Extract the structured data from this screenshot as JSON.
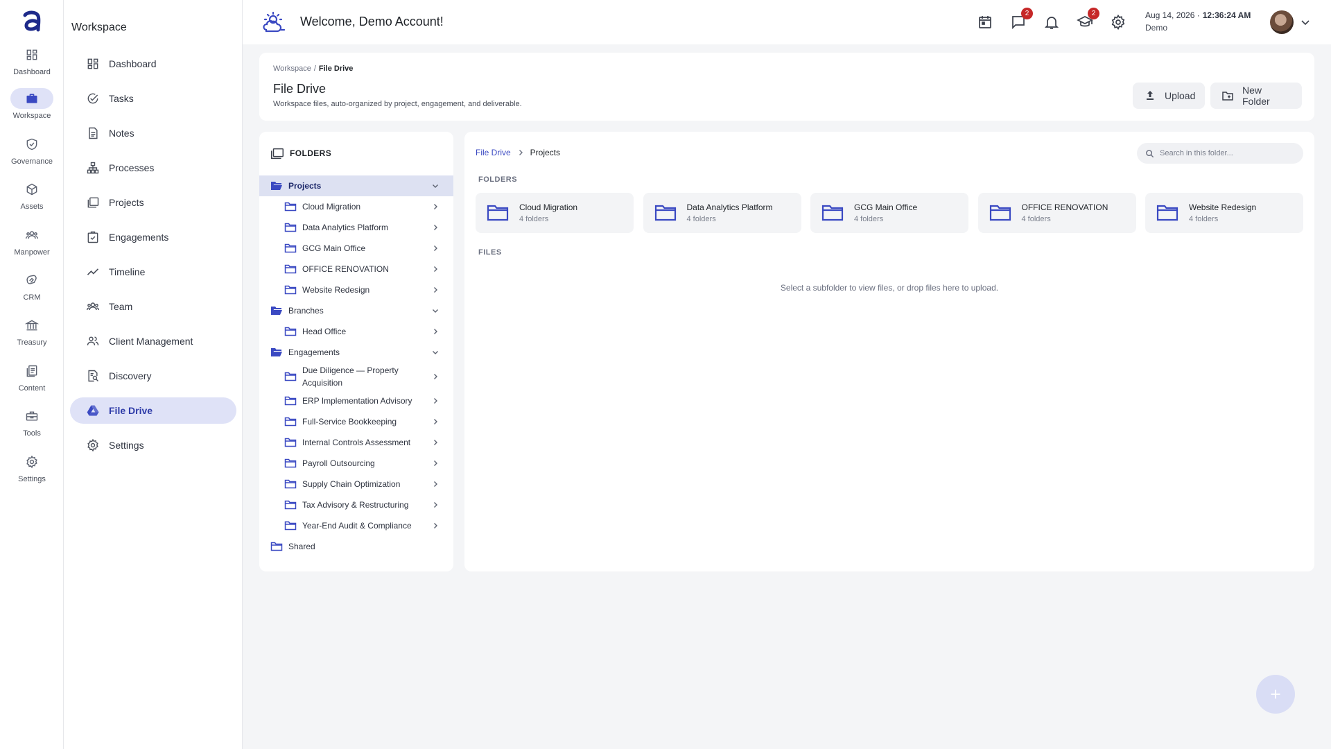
{
  "rail": {
    "items": [
      {
        "label": "Dashboard",
        "icon": "dashboard-icon"
      },
      {
        "label": "Workspace",
        "icon": "briefcase-icon"
      },
      {
        "label": "Governance",
        "icon": "shield-check-icon"
      },
      {
        "label": "Assets",
        "icon": "cube-icon"
      },
      {
        "label": "Manpower",
        "icon": "people-icon"
      },
      {
        "label": "CRM",
        "icon": "handshake-icon"
      },
      {
        "label": "Treasury",
        "icon": "bank-icon"
      },
      {
        "label": "Content",
        "icon": "document-stack-icon"
      },
      {
        "label": "Tools",
        "icon": "toolbox-icon"
      },
      {
        "label": "Settings",
        "icon": "gear-icon"
      }
    ]
  },
  "sidebar": {
    "title": "Workspace",
    "items": [
      {
        "label": "Dashboard"
      },
      {
        "label": "Tasks"
      },
      {
        "label": "Notes"
      },
      {
        "label": "Processes"
      },
      {
        "label": "Projects"
      },
      {
        "label": "Engagements"
      },
      {
        "label": "Timeline"
      },
      {
        "label": "Team"
      },
      {
        "label": "Client Management"
      },
      {
        "label": "Discovery"
      },
      {
        "label": "File Drive"
      },
      {
        "label": "Settings"
      }
    ]
  },
  "header": {
    "title": "Welcome, Demo Account!",
    "messages_badge": "2",
    "courses_badge": "2",
    "date": "Aug 14, 2026 ·",
    "time": "12:36:24 AM",
    "user": "Demo"
  },
  "page": {
    "breadcrumb_root": "Workspace",
    "breadcrumb_sep": "/",
    "breadcrumb_current": "File Drive",
    "title": "File Drive",
    "subtitle": "Workspace files, auto-organized by project, engagement, and deliverable.",
    "upload_label": "Upload",
    "new_folder_label": "New Folder"
  },
  "tree": {
    "heading": "FOLDERS",
    "rows": [
      {
        "label": "Projects"
      },
      {
        "label": "Cloud Migration"
      },
      {
        "label": "Data Analytics Platform"
      },
      {
        "label": "GCG Main Office"
      },
      {
        "label": "OFFICE RENOVATION"
      },
      {
        "label": "Website Redesign"
      },
      {
        "label": "Branches"
      },
      {
        "label": "Head Office"
      },
      {
        "label": "Engagements"
      },
      {
        "label": "Due Diligence — Property Acquisition"
      },
      {
        "label": "ERP Implementation Advisory"
      },
      {
        "label": "Full-Service Bookkeeping"
      },
      {
        "label": "Internal Controls Assessment"
      },
      {
        "label": "Payroll Outsourcing"
      },
      {
        "label": "Supply Chain Optimization"
      },
      {
        "label": "Tax Advisory & Restructuring"
      },
      {
        "label": "Year-End Audit & Compliance"
      },
      {
        "label": "Shared"
      }
    ]
  },
  "content": {
    "crumb_root": "File Drive",
    "crumb_current": "Projects",
    "search_placeholder": "Search in this folder...",
    "folders_label": "FOLDERS",
    "files_label": "FILES",
    "folders": [
      {
        "name": "Cloud Migration",
        "sub": "4 folders"
      },
      {
        "name": "Data Analytics Platform",
        "sub": "4 folders"
      },
      {
        "name": "GCG Main Office",
        "sub": "4 folders"
      },
      {
        "name": "OFFICE RENOVATION",
        "sub": "4 folders"
      },
      {
        "name": "Website Redesign",
        "sub": "4 folders"
      }
    ],
    "empty_text": "Select a subfolder to view files, or drop files here to upload."
  },
  "colors": {
    "accent": "#3a49c2",
    "active_bg": "#dfe2f7",
    "badge": "#c62828"
  }
}
